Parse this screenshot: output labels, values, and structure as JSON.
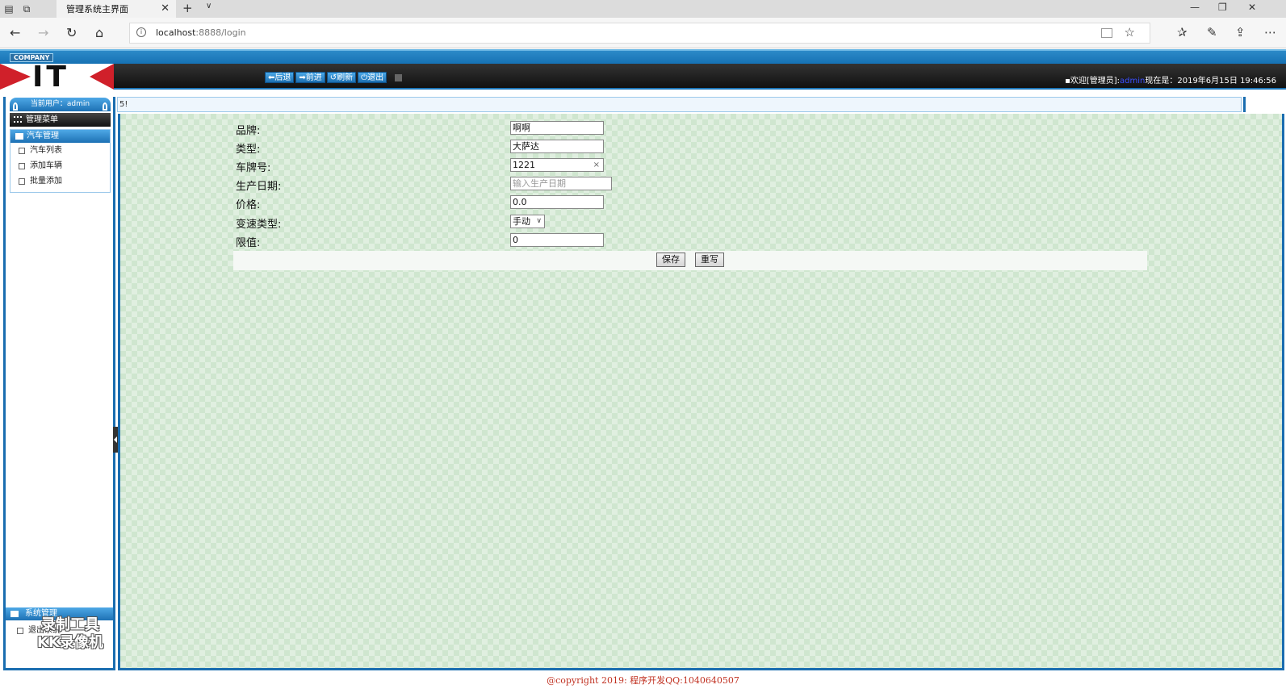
{
  "browser": {
    "tab_title": "管理系统主界面",
    "url_host": "localhost",
    "url_port_path": ":8888/login"
  },
  "header": {
    "company": "COMPANY",
    "logo_text": "IT",
    "buttons": [
      "⬅后退",
      "➡前进",
      "↺刷新",
      "⏻退出"
    ],
    "welcome_prefix": "▪欢迎[管理员]:",
    "welcome_user": "admin",
    "time_label": "现在是：2019年6月15日 19:46:56"
  },
  "sidebar": {
    "current_user": "当前用户：admin",
    "menu_title": "管理菜单",
    "group_title": "汽车管理",
    "items": [
      "汽车列表",
      "添加车辆",
      "批量添加"
    ],
    "sys_title": "系统管理",
    "sys_item": "退出系统"
  },
  "watermark": {
    "line1": "录制工具",
    "line2": "KK录像机"
  },
  "content": {
    "top_text": "5!"
  },
  "form": {
    "brand_label": "品牌:",
    "brand_value": "啊啊",
    "type_label": "类型:",
    "type_value": "大萨达",
    "plate_label": "车牌号:",
    "plate_value": "1221",
    "date_label": "生产日期:",
    "date_placeholder": "输入生产日期",
    "price_label": "价格:",
    "price_value": "0.0",
    "gearbox_label": "变速类型:",
    "gearbox_value": "手动",
    "limit_label": "限值:",
    "limit_value": "0",
    "save_label": "保存",
    "reset_label": "重写"
  },
  "footer": {
    "copyright": "@copyright 2019: 程序开发QQ:1040640507"
  },
  "colors": {
    "accent_blue": "#1a6db0",
    "content_bg": "#cfe6cf",
    "copyright_red": "#c03020"
  }
}
